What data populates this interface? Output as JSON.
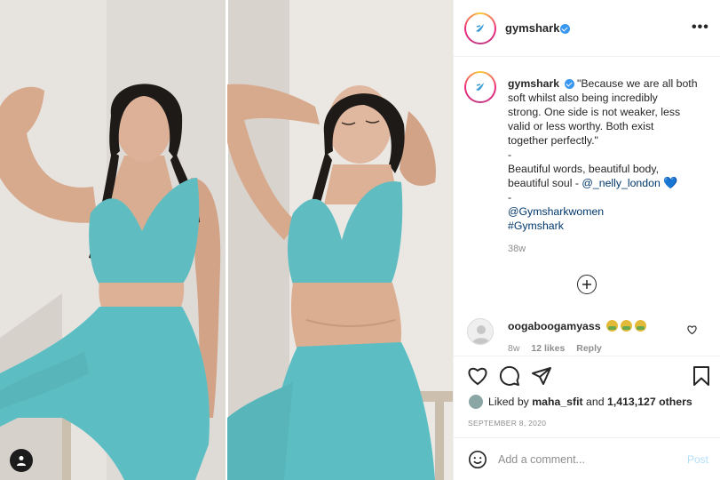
{
  "post": {
    "account": "gymshark",
    "header_more": "•••",
    "caption": {
      "username": "gymshark",
      "lines": [
        "\"Because we are all both",
        "soft whilst also being incredibly",
        "strong. One side is not weaker, less",
        "valid or less worthy. Both exist",
        "together perfectly.\"",
        "-",
        "Beautiful words, beautiful body,",
        "beautiful soul - ",
        "-"
      ],
      "mention_user": "@_nelly_london",
      "heart": "💙",
      "tag_mention": "@Gymsharkwomen",
      "hashtag": "#Gymshark",
      "time_ago": "38w"
    },
    "comment": {
      "username": "oogaboogamyass",
      "time": "8w",
      "likes": "12 likes",
      "reply": "Reply"
    },
    "likes": {
      "prefix": "Liked by ",
      "user": "maha_sfit",
      "middle": " and ",
      "count": "1,413,127 others"
    },
    "date": "SEPTEMBER 8, 2020",
    "add_comment": {
      "placeholder": "Add a comment...",
      "post_label": "Post"
    }
  },
  "icons": {
    "avatar": "gymshark-logo-icon",
    "verified": "verified-badge-icon",
    "load_more": "plus-circle-icon",
    "like": "heart-icon",
    "comment": "comment-bubble-icon",
    "share": "paper-plane-icon",
    "save": "bookmark-icon",
    "emoji": "smiley-icon",
    "user_tags": "user-tag-icon"
  },
  "colors": {
    "text": "#262626",
    "muted": "#8e8e8e",
    "link": "#00376b",
    "verified": "#3897f0",
    "post_disabled": "#b2dffc",
    "outfit_teal": "#5fbcc0"
  }
}
